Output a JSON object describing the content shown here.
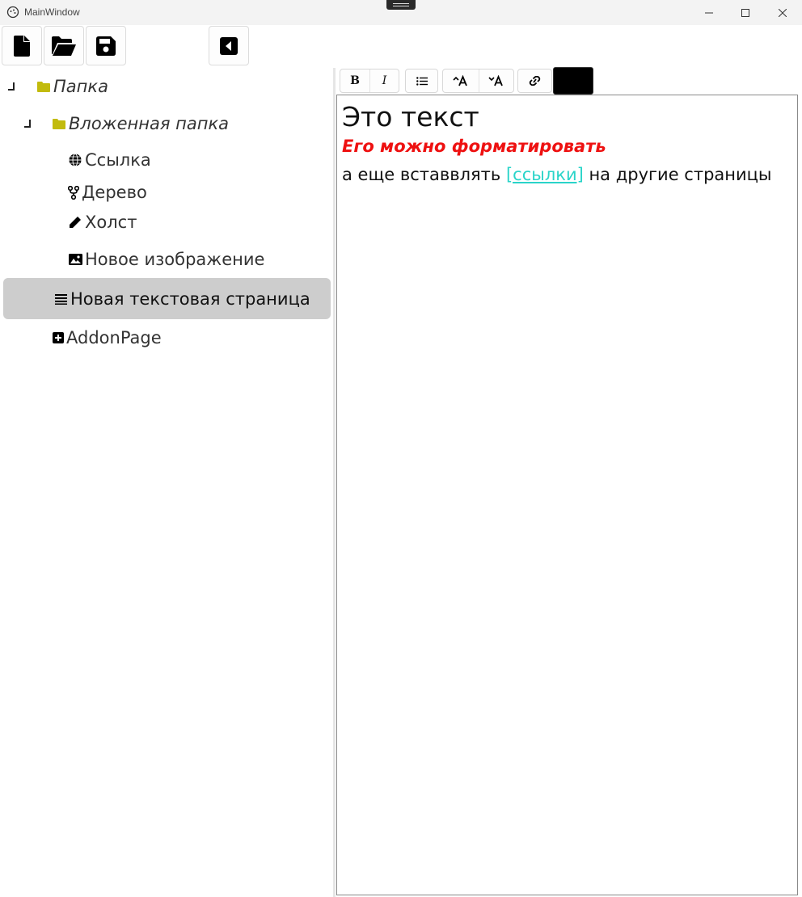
{
  "window": {
    "title": "MainWindow"
  },
  "toolbar": {
    "buttons": [
      {
        "icon": "new-file-icon"
      },
      {
        "icon": "open-folder-icon"
      },
      {
        "icon": "save-icon"
      },
      {
        "icon": "collapse-panel-icon"
      }
    ]
  },
  "tree": {
    "items": [
      {
        "label": "Папка",
        "icon": "folder-icon",
        "expanded": true
      },
      {
        "label": "Вложенная папка",
        "icon": "folder-icon",
        "expanded": true
      },
      {
        "label": "Ссылка",
        "icon": "globe-icon"
      },
      {
        "label": "Дерево",
        "icon": "tree-branch-icon"
      },
      {
        "label": "Холст",
        "icon": "pencil-icon"
      },
      {
        "label": "Новое изображение",
        "icon": "image-icon"
      },
      {
        "label": "Новая текстовая страница",
        "icon": "text-lines-icon",
        "selected": true
      },
      {
        "label": "AddonPage",
        "icon": "plus-square-icon"
      }
    ]
  },
  "editor_toolbar": {
    "bold": "B",
    "italic": "I",
    "text_color": "#000000"
  },
  "editor": {
    "heading": "Это текст",
    "formatted": "Его можно форматировать",
    "line3_before": "а еще вставвлять ",
    "link_text": "[ссылки]",
    "line3_after": " на другие страницы",
    "colors": {
      "formatted_text": "#ee1111",
      "link": "#2ad4c9"
    }
  }
}
